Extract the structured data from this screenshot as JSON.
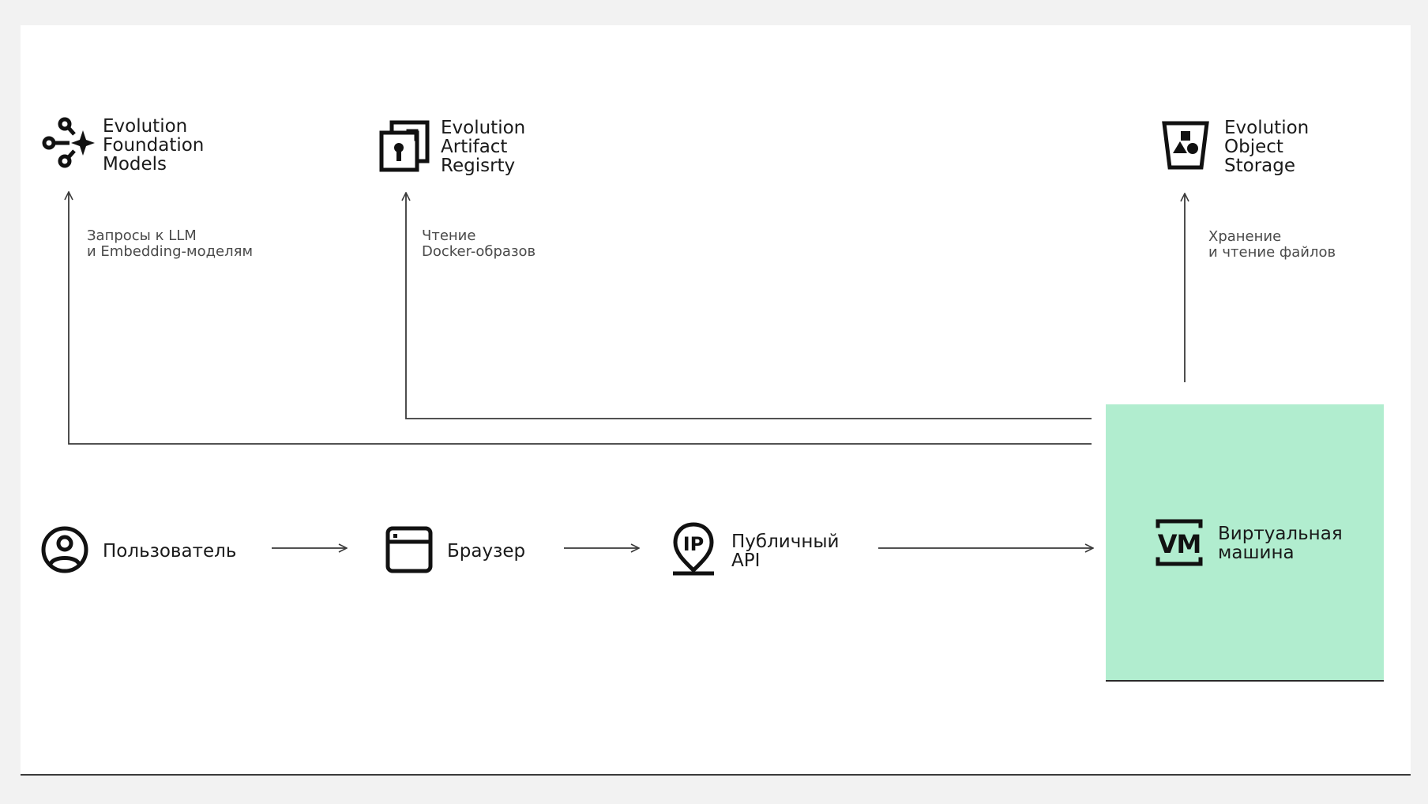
{
  "nodes": {
    "foundation_models": {
      "line1": "Evolution",
      "line2": "Foundation",
      "line3": "Models"
    },
    "artifact_registry": {
      "line1": "Evolution",
      "line2": "Artifact",
      "line3": "Regisrty"
    },
    "object_storage": {
      "line1": "Evolution",
      "line2": "Object",
      "line3": "Storage"
    },
    "user": {
      "label": "Пользователь"
    },
    "browser": {
      "label": "Браузер"
    },
    "public_api": {
      "line1": "Публичный",
      "line2": "API"
    },
    "virtual_machine": {
      "line1": "Виртуальная",
      "line2": "машина"
    }
  },
  "edges": {
    "llm": {
      "line1": "Запросы к LLM",
      "line2": "и Embedding-моделям"
    },
    "docker": {
      "line1": "Чтение",
      "line2": "Docker-образов"
    },
    "storage": {
      "line1": "Хранение",
      "line2": "и чтение файлов"
    }
  },
  "icons": {
    "foundation_models": "foundation-models-icon",
    "artifact_registry": "artifact-registry-icon",
    "object_storage": "object-storage-icon",
    "user": "user-icon",
    "browser": "browser-window-icon",
    "public_api": "ip-pin-icon",
    "virtual_machine": "vm-icon"
  },
  "colors": {
    "vm_background": "#b1edcf",
    "line": "#3a3a3a"
  }
}
